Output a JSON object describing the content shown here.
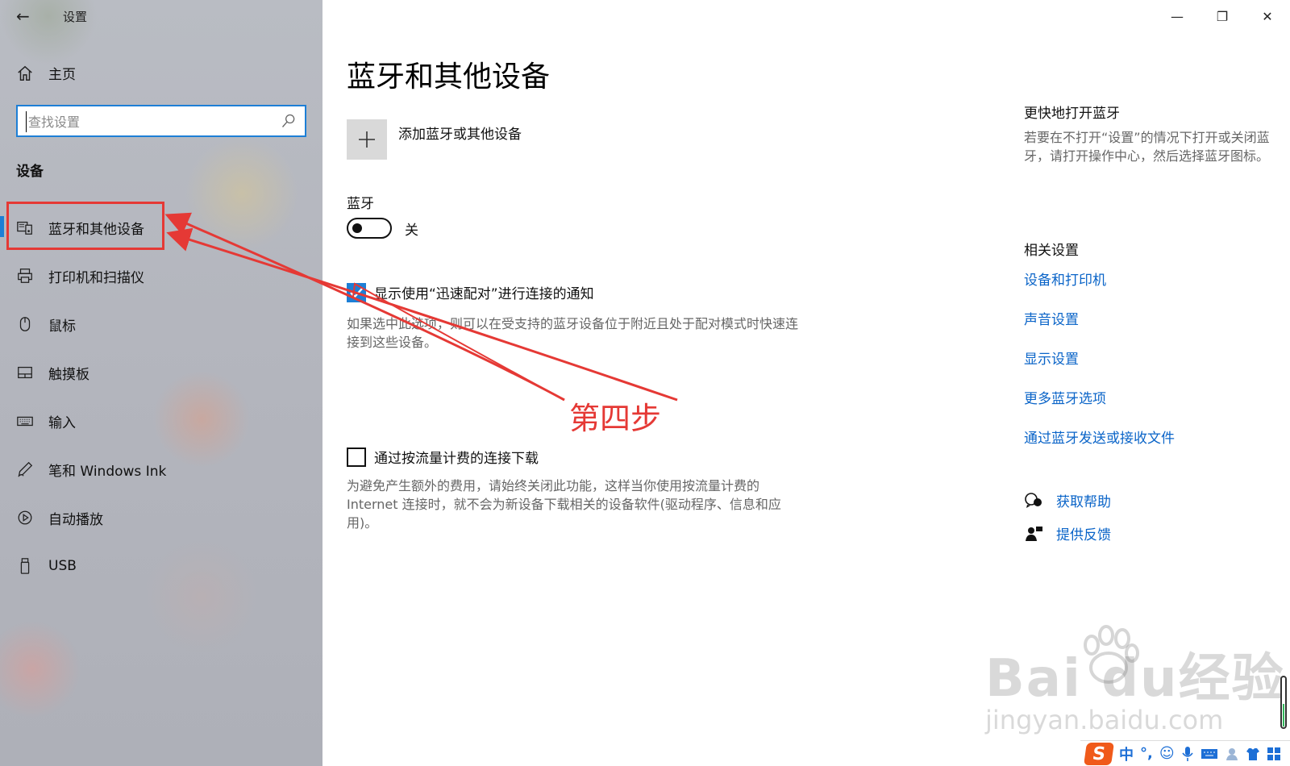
{
  "window": {
    "title": "设置",
    "back_glyph": "←",
    "controls": {
      "minimize": "—",
      "maximize": "❐",
      "close": "✕"
    }
  },
  "sidebar": {
    "home_label": "主页",
    "search_placeholder": "查找设置",
    "section_heading": "设备",
    "items": [
      {
        "label": "蓝牙和其他设备",
        "icon": "bluetooth-devices-icon",
        "selected": true
      },
      {
        "label": "打印机和扫描仪",
        "icon": "printer-icon"
      },
      {
        "label": "鼠标",
        "icon": "mouse-icon"
      },
      {
        "label": "触摸板",
        "icon": "touchpad-icon"
      },
      {
        "label": "输入",
        "icon": "keyboard-icon"
      },
      {
        "label": "笔和 Windows Ink",
        "icon": "pen-icon"
      },
      {
        "label": "自动播放",
        "icon": "autoplay-icon"
      },
      {
        "label": "USB",
        "icon": "usb-icon"
      }
    ]
  },
  "main": {
    "title": "蓝牙和其他设备",
    "add_device_label": "添加蓝牙或其他设备",
    "bluetooth_label": "蓝牙",
    "toggle_state": "关",
    "swift_pair": {
      "label": "显示使用“迅速配对”进行连接的通知",
      "checked": true,
      "description": "如果选中此选项，则可以在受支持的蓝牙设备位于附近且处于配对模式时快速连接到这些设备。"
    },
    "metered": {
      "label": "通过按流量计费的连接下载",
      "checked": false,
      "description": "为避免产生额外的费用，请始终关闭此功能，这样当你使用按流量计费的 Internet 连接时，就不会为新设备下载相关的设备软件(驱动程序、信息和应用)。"
    }
  },
  "right": {
    "quick_heading": "更快地打开蓝牙",
    "quick_text": "若要在不打开“设置”的情况下打开或关闭蓝牙，请打开操作中心，然后选择蓝牙图标。",
    "related_heading": "相关设置",
    "links": [
      "设备和打印机",
      "声音设置",
      "显示设置",
      "更多蓝牙选项",
      "通过蓝牙发送或接收文件"
    ],
    "help": "获取帮助",
    "feedback": "提供反馈"
  },
  "annotation": {
    "step_text": "第四步",
    "color": "#e53935"
  },
  "watermark": {
    "main": "Bai du经验",
    "url": "jingyan.baidu.com"
  },
  "ime": {
    "logo": "S",
    "mode": "中",
    "punct": "°,",
    "emoji": "☺"
  }
}
